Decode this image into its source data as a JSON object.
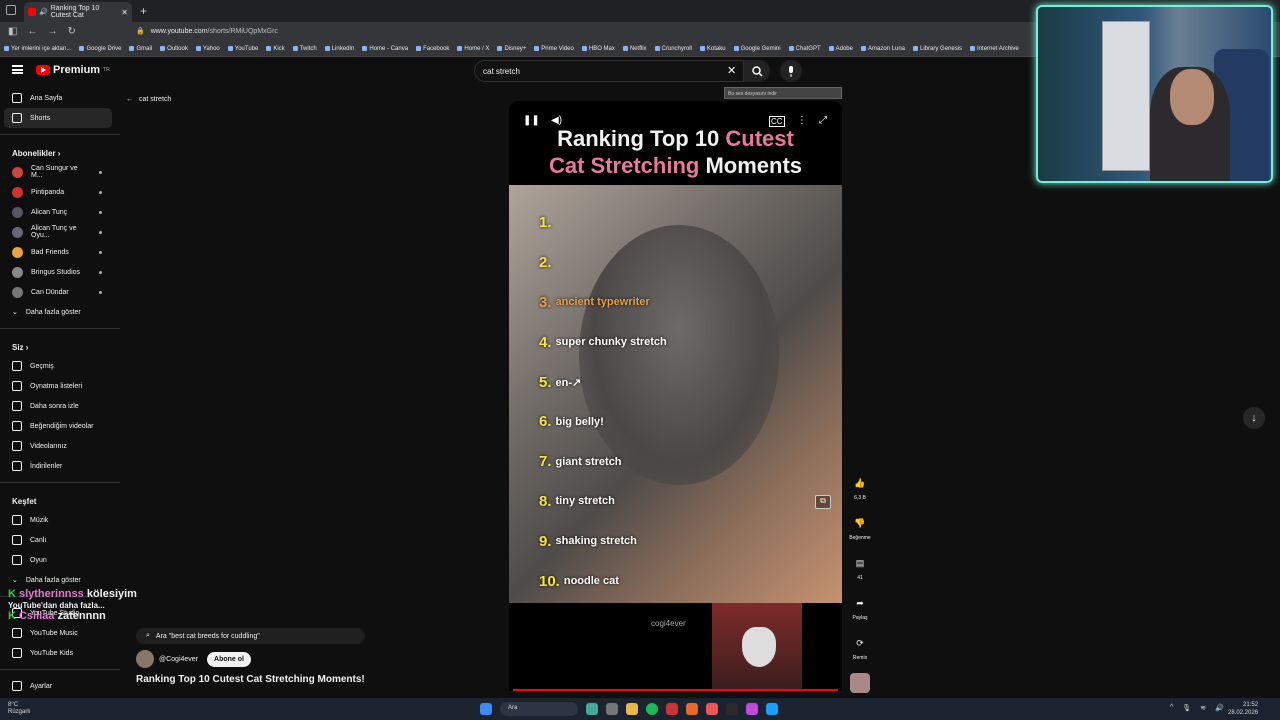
{
  "browser": {
    "tab_title": "Ranking Top 10 Cutest Cat",
    "url_prefix": "www.youtube.com",
    "url_path": "/shorts/RMiUQpMxGrc",
    "bookmarks": [
      "Yer imlerini içe aktarı...",
      "Google Drive",
      "Gmail",
      "Outlook",
      "Yahoo",
      "YouTube",
      "Kick",
      "Twitch",
      "LinkedIn",
      "Home - Canva",
      "Facebook",
      "Home / X",
      "Disney+",
      "Prime Video",
      "HBO Max",
      "Netflix",
      "Crunchyroll",
      "Kotaku",
      "Google Gemini",
      "ChatGPT",
      "Adobe",
      "Amazon Luna",
      "Library Genesis",
      "Internet Archive"
    ]
  },
  "header": {
    "logo": "Premium",
    "logo_sup": "TR",
    "search_value": "cat stretch"
  },
  "sidebar": {
    "main": [
      {
        "label": "Ana Sayfa",
        "icon": "home-icon"
      },
      {
        "label": "Shorts",
        "icon": "shorts-icon"
      }
    ],
    "subs_title": "Abonelikler",
    "subs": [
      {
        "label": "Can Sungur ve M...",
        "color": "#c44"
      },
      {
        "label": "Pintipanda",
        "color": "#c33"
      },
      {
        "label": "Alican Tunç",
        "color": "#556"
      },
      {
        "label": "Alican Tunç ve Oyu...",
        "color": "#667"
      },
      {
        "label": "Bad Friends",
        "color": "#e8a33a"
      },
      {
        "label": "Bringus Studios",
        "color": "#888"
      },
      {
        "label": "Can Dündar",
        "color": "#777"
      }
    ],
    "show_more": "Daha fazla göster",
    "you_title": "Siz",
    "you": [
      {
        "label": "Geçmiş"
      },
      {
        "label": "Oynatma listeleri"
      },
      {
        "label": "Daha sonra izle"
      },
      {
        "label": "Beğendiğim videolar"
      },
      {
        "label": "Videolarınız"
      },
      {
        "label": "İndirilenler"
      }
    ],
    "explore_title": "Keşfet",
    "explore": [
      {
        "label": "Müzik"
      },
      {
        "label": "Canlı"
      },
      {
        "label": "Oyun"
      }
    ],
    "show_more2": "Daha fazla göster",
    "more": [
      {
        "label": "YouTube Studio"
      },
      {
        "label": "YouTube Music"
      },
      {
        "label": "YouTube Kids"
      }
    ],
    "settings": "Ayarlar"
  },
  "back_label": "cat stretch",
  "video": {
    "title_w1": "Ranking Top 10 ",
    "title_pink1": "Cutest",
    "title_pink2": "Cat Stretching",
    "title_w2": " Moments",
    "items": [
      {
        "n": "1.",
        "t": ""
      },
      {
        "n": "2.",
        "t": ""
      },
      {
        "n": "3.",
        "t": "ancient typewriter"
      },
      {
        "n": "4.",
        "t": "super chunky stretch"
      },
      {
        "n": "5.",
        "t": "en-↗"
      },
      {
        "n": "6.",
        "t": "big belly!"
      },
      {
        "n": "7.",
        "t": "giant stretch"
      },
      {
        "n": "8.",
        "t": "tiny stretch"
      },
      {
        "n": "9.",
        "t": "shaking stretch"
      },
      {
        "n": "10.",
        "t": "noodle cat"
      }
    ],
    "streamer_handle": "cogi4ever",
    "promo": "Bu ses dosyasını indir"
  },
  "actions": {
    "likes": "6,3 B",
    "dislike": "Beğenme",
    "comments": "41",
    "share": "Paylaş",
    "remix": "Remix"
  },
  "meta": {
    "chip": "Ara \"best cat breeds for cuddling\"",
    "channel": "@Cogi4ever",
    "subscribe": "Abone ol",
    "title": "Ranking Top 10 Cutest Cat Stretching Moments!"
  },
  "chat_overlay": {
    "user1": "slytherinnss",
    "msg1": "kölesiyim",
    "line2": "YouTube'dan daha fazla...",
    "user2": "Csillaa",
    "msg2": "zatennnn"
  },
  "taskbar": {
    "temp": "8°C",
    "weather": "Rüzgarlı",
    "search": "Ara",
    "time": "21:52",
    "date": "28.02.2026"
  }
}
